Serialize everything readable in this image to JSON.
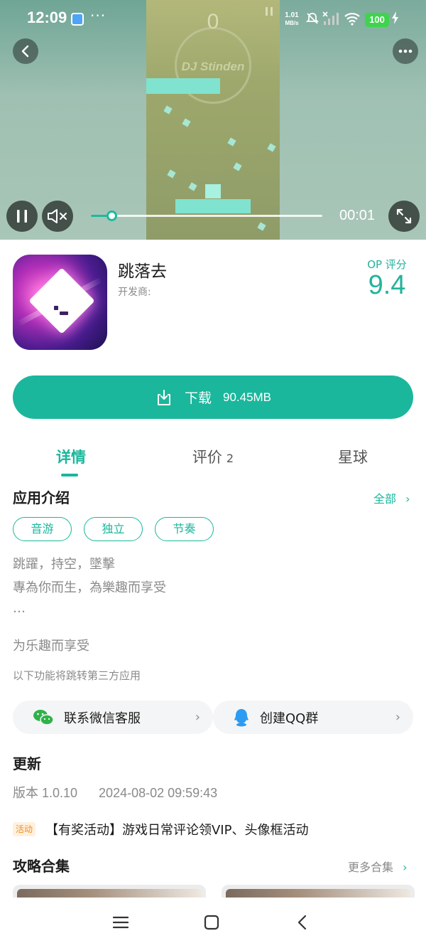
{
  "status_bar": {
    "time": "12:09",
    "more": "···",
    "net_speed_value": "1.01",
    "net_speed_unit": "MB/s",
    "battery": "100"
  },
  "video": {
    "game_score": "0",
    "game_logo_text": "DJ Stinden",
    "elapsed": "00:01",
    "progress": 0.09
  },
  "app": {
    "name": "跳落去",
    "developer_label": "开发商:",
    "rating_label": "OP 评分",
    "rating_value": "9.4"
  },
  "download": {
    "label": "下载",
    "size": "90.45MB"
  },
  "tabs": [
    {
      "label": "详情",
      "count": ""
    },
    {
      "label": "评价",
      "count": "2"
    },
    {
      "label": "星球",
      "count": ""
    }
  ],
  "intro": {
    "title": "应用介绍",
    "more": "全部",
    "tags": [
      "音游",
      "独立",
      "节奏"
    ],
    "desc_lines": [
      "跳躍，持空，墜擊",
      "專為你而生，為樂趣而享受",
      "…"
    ],
    "tagline": "为乐趣而享受",
    "third_party_note": "以下功能将跳转第三方应用"
  },
  "actions": {
    "wechat": "联系微信客服",
    "qq": "创建QQ群"
  },
  "update": {
    "title": "更新",
    "version": "版本 1.0.10",
    "datetime": "2024-08-02 09:59:43"
  },
  "activity": {
    "badge": "活动",
    "text": "【有奖活动】游戏日常评论领VIP、头像框活动"
  },
  "guides": {
    "title": "攻略合集",
    "more": "更多合集"
  },
  "colors": {
    "accent": "#1ab79c",
    "battery": "#3fd34e",
    "activity": "#f08c2a"
  }
}
